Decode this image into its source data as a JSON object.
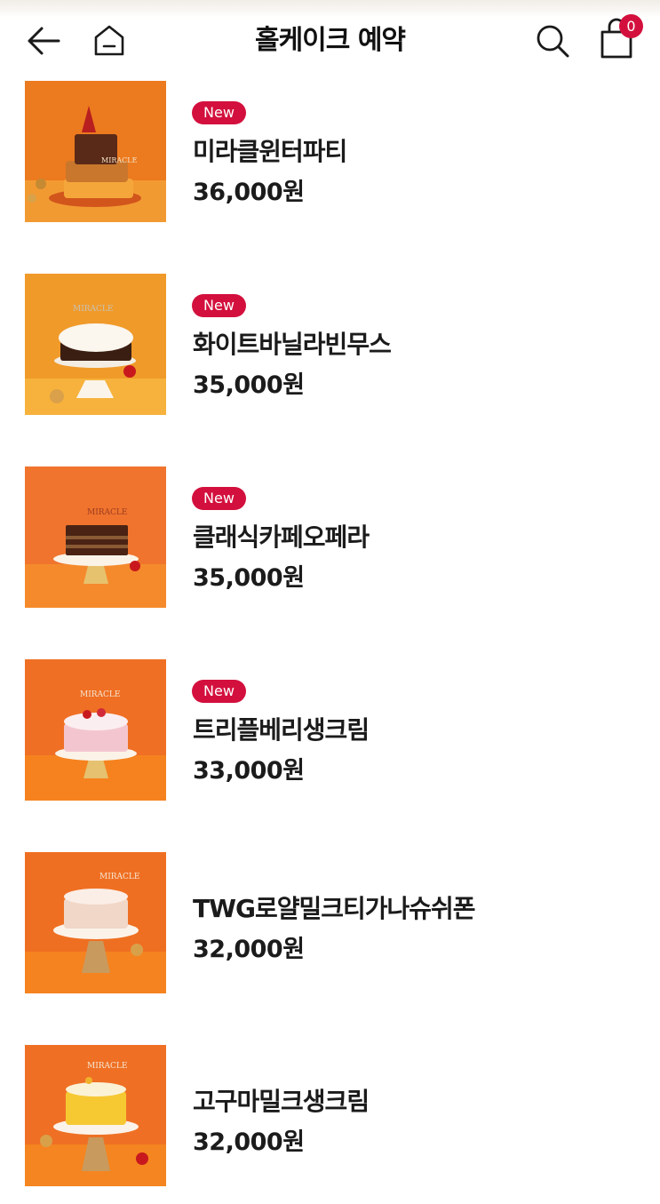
{
  "header": {
    "title": "홀케이크 예약",
    "cart_count": "0",
    "icons": [
      "arrow-left-icon",
      "home-icon",
      "search-icon",
      "shopping-bag-icon"
    ]
  },
  "products": [
    {
      "badge": "New",
      "name": "미라클윈터파티",
      "price": "36,000원"
    },
    {
      "badge": "New",
      "name": "화이트바닐라빈무스",
      "price": "35,000원"
    },
    {
      "badge": "New",
      "name": "클래식카페오페라",
      "price": "35,000원"
    },
    {
      "badge": "New",
      "name": "트리플베리생크림",
      "price": "33,000원"
    },
    {
      "name": "TWG로얄밀크티가나슈쉬폰",
      "price": "32,000원"
    },
    {
      "name": "고구마밀크생크림",
      "price": "32,000원"
    }
  ],
  "colors": {
    "accent": "#d3103d",
    "thumb_orange": "#f07a1e"
  }
}
